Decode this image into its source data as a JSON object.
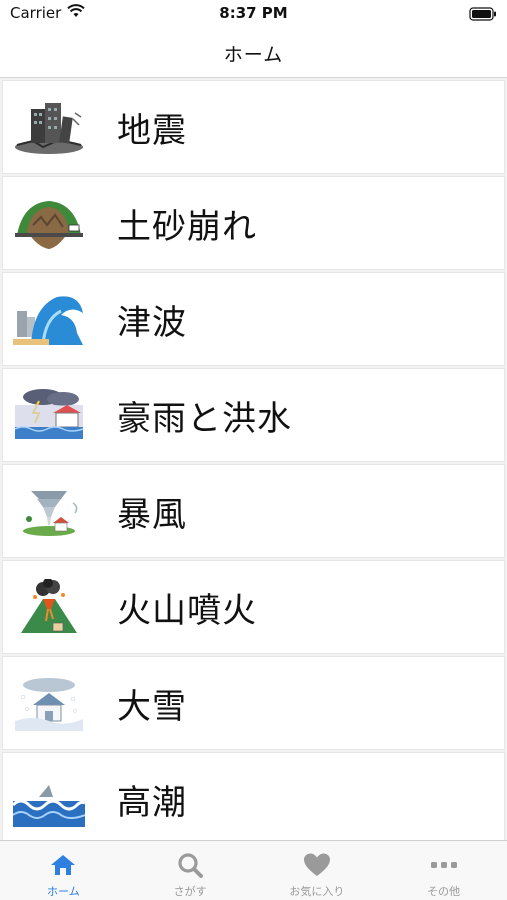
{
  "status_bar": {
    "carrier": "Carrier",
    "time": "8:37 PM"
  },
  "nav": {
    "title": "ホーム"
  },
  "items": [
    {
      "label": "地震",
      "icon": "earthquake-icon"
    },
    {
      "label": "土砂崩れ",
      "icon": "landslide-icon"
    },
    {
      "label": "津波",
      "icon": "tsunami-icon"
    },
    {
      "label": "豪雨と洪水",
      "icon": "heavy-rain-flood-icon"
    },
    {
      "label": "暴風",
      "icon": "storm-icon"
    },
    {
      "label": "火山噴火",
      "icon": "volcano-icon"
    },
    {
      "label": "大雪",
      "icon": "heavy-snow-icon"
    },
    {
      "label": "高潮",
      "icon": "storm-surge-icon"
    }
  ],
  "tabs": [
    {
      "label": "ホーム",
      "icon": "home-icon",
      "active": true
    },
    {
      "label": "さがす",
      "icon": "search-icon",
      "active": false
    },
    {
      "label": "お気に入り",
      "icon": "heart-icon",
      "active": false
    },
    {
      "label": "その他",
      "icon": "more-icon",
      "active": false
    }
  ],
  "colors": {
    "accent": "#2f7fe0",
    "inactive": "#9a9a9a"
  }
}
